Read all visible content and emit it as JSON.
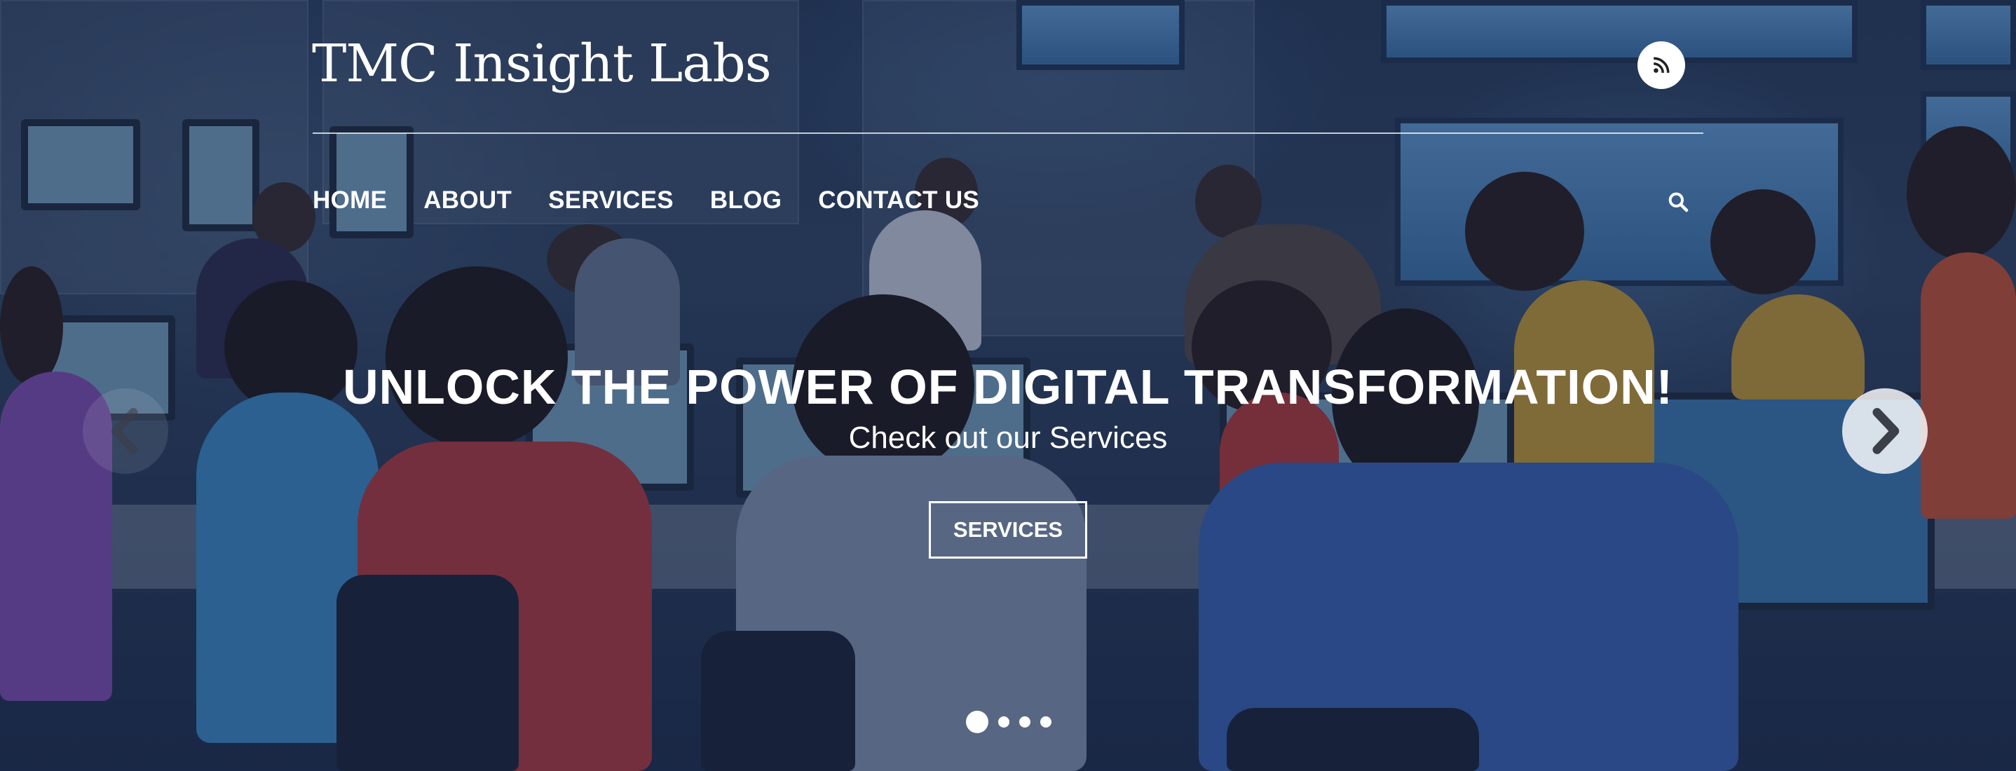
{
  "site": {
    "title": "TMC Insight Labs",
    "rss_icon": "rss-icon",
    "search_icon": "search-icon"
  },
  "nav": {
    "items": [
      {
        "label": "HOME"
      },
      {
        "label": "ABOUT"
      },
      {
        "label": "SERVICES"
      },
      {
        "label": "BLOG"
      },
      {
        "label": "CONTACT US"
      }
    ]
  },
  "slider": {
    "heading": "UNLOCK THE POWER OF DIGITAL TRANSFORMATION!",
    "subheading": "Check out our Services",
    "button_label": "SERVICES",
    "prev_icon": "chevron-left-icon",
    "next_icon": "chevron-right-icon",
    "slide_count": 4,
    "active_slide": 1
  },
  "colors": {
    "text": "#ffffff",
    "overlay": "#14234a"
  }
}
